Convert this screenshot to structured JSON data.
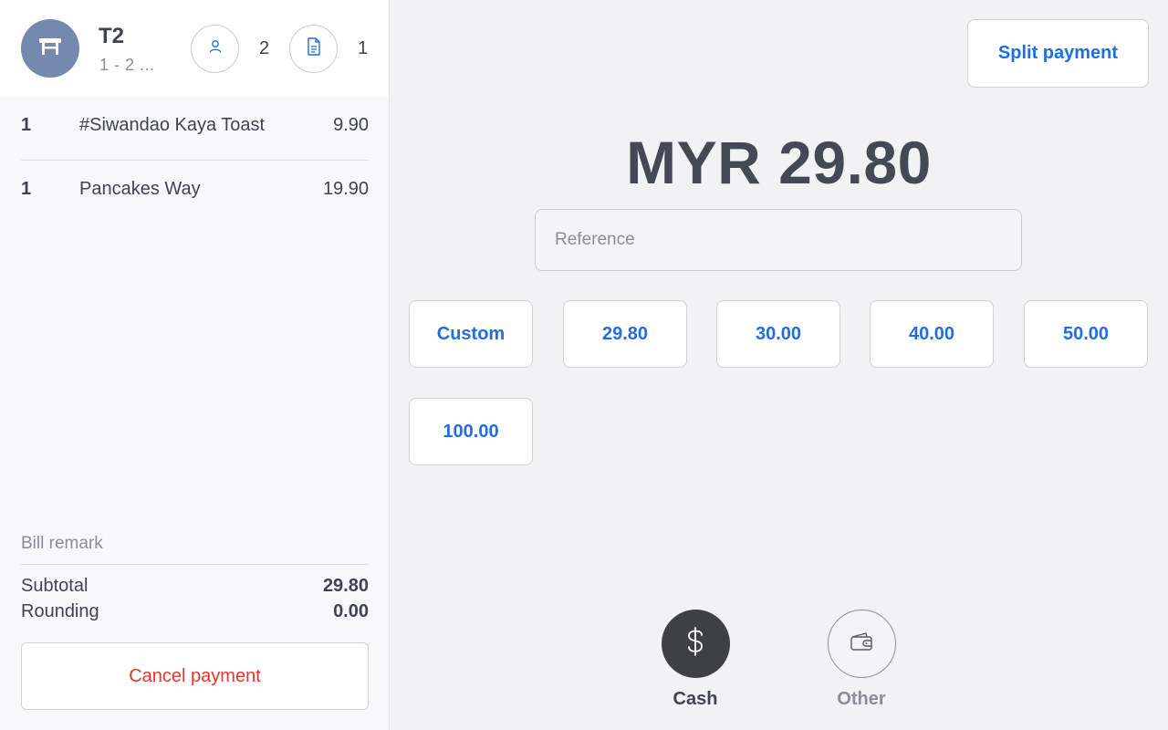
{
  "order": {
    "table_name": "T2",
    "table_sub": "1 - 2 ...",
    "table_icon": "table-icon",
    "guests_icon": "person-icon",
    "guests_count": "2",
    "bills_icon": "document-icon",
    "bills_count": "1"
  },
  "items": [
    {
      "qty": "1",
      "name": "#Siwandao Kaya Toast",
      "price": "9.90"
    },
    {
      "qty": "1",
      "name": "Pancakes Way",
      "price": "19.90"
    }
  ],
  "summary": {
    "bill_remark": "Bill remark",
    "subtotal_label": "Subtotal",
    "subtotal_value": "29.80",
    "rounding_label": "Rounding",
    "rounding_value": "0.00",
    "cancel_label": "Cancel payment"
  },
  "payment": {
    "split_label": "Split payment",
    "total": "MYR 29.80",
    "reference_placeholder": "Reference",
    "reference_value": "",
    "quick_amounts": [
      "Custom",
      "29.80",
      "30.00",
      "40.00",
      "50.00",
      "100.00"
    ],
    "methods": [
      {
        "label": "Cash",
        "icon": "dollar-icon",
        "active": true
      },
      {
        "label": "Other",
        "icon": "wallet-icon",
        "active": false
      }
    ]
  },
  "colors": {
    "accent": "#1f6fe0",
    "danger": "#e8332b",
    "avatar": "#7489ad",
    "text": "#3f4350",
    "muted": "#8a8d96"
  }
}
